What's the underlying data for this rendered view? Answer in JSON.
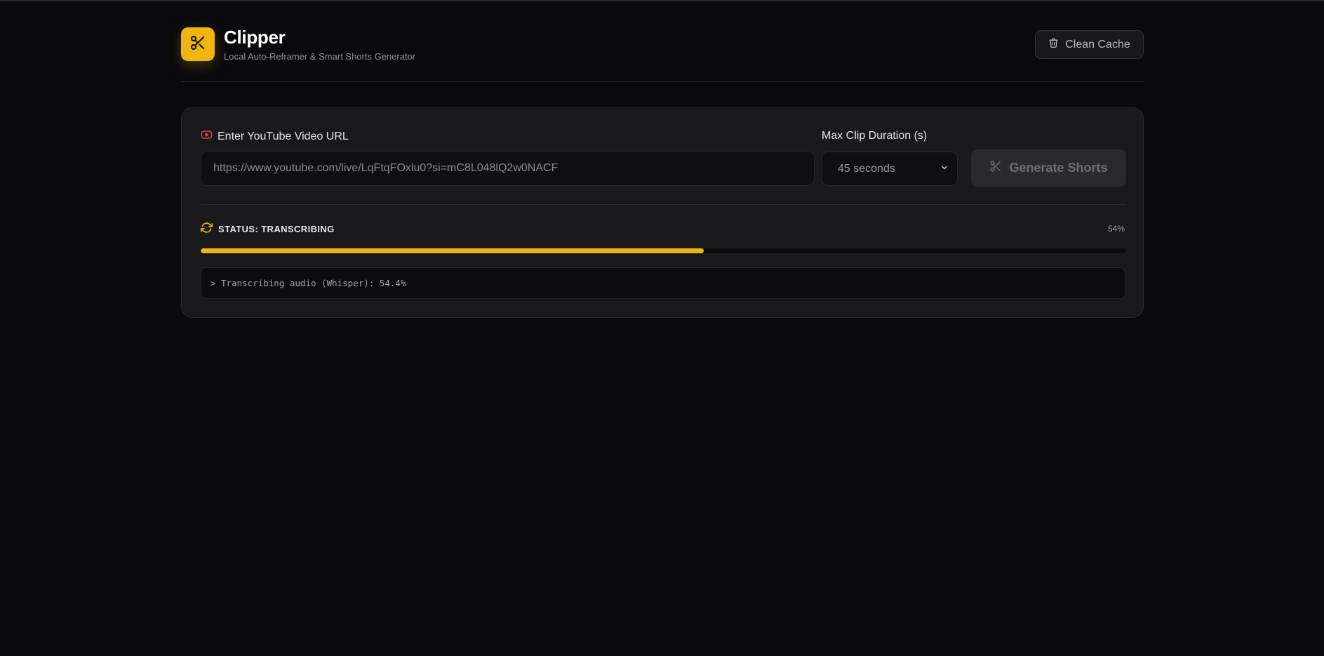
{
  "app": {
    "title": "Clipper",
    "subtitle": "Local Auto-Reframer & Smart Shorts Generator",
    "logo_icon": "scissors-icon",
    "accent_color": "#f0b512"
  },
  "header": {
    "clean_cache_label": "Clean Cache",
    "clean_cache_icon": "trash-icon"
  },
  "form": {
    "url_label": "Enter YouTube Video URL",
    "url_icon": "youtube-icon",
    "url_value": "https://www.youtube.com/live/LqFtqFOxlu0?si=mC8L048lQ2w0NACF",
    "duration_label": "Max Clip Duration (s)",
    "duration_selected": "45 seconds",
    "generate_label": "Generate Shorts",
    "generate_icon": "scissors-icon"
  },
  "status": {
    "text": "STATUS: TRANSCRIBING",
    "icon": "refresh-icon",
    "percent_label": "54%",
    "progress": 0.544,
    "log_line": "> Transcribing audio (Whisper): 54.4%"
  }
}
